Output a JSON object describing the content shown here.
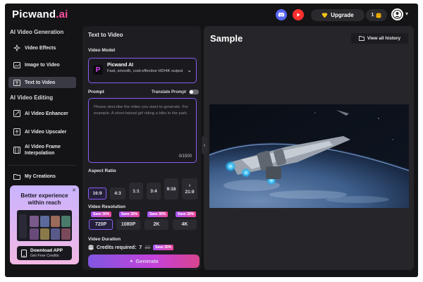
{
  "app": {
    "logo_text": "Picwand",
    "logo_suffix": ".ai"
  },
  "topbar": {
    "upgrade_label": "Upgrade",
    "credits": "1"
  },
  "sidebar": {
    "section1": "AI Video Generation",
    "items1": [
      {
        "label": "Video Effects",
        "icon": "video-effects-icon"
      },
      {
        "label": "Image to Video",
        "icon": "image-icon"
      },
      {
        "label": "Text to Video",
        "icon": "text-icon",
        "active": true
      }
    ],
    "section2": "AI Video Editing",
    "items2": [
      {
        "label": "AI Video Enhancer",
        "icon": "enhancer-icon"
      },
      {
        "label": "AI Video Upscaler",
        "icon": "upscaler-icon"
      },
      {
        "label": "AI Video Frame Interpolation",
        "line1": "AI Video Frame",
        "line2": "Interpolation",
        "icon": "frame-icon"
      }
    ],
    "creations": "My Creations"
  },
  "promo": {
    "title_line1": "Better experience",
    "title_line2": "within reach",
    "download_label": "Download APP",
    "download_sub": "Get Free Credits"
  },
  "panel": {
    "title": "Text to Video",
    "model_label": "Video Model",
    "model_name": "Picwand AI",
    "model_desc": "Fast, smooth, cost-effective HD/4K output",
    "prompt_label": "Prompt",
    "translate_label": "Translate Prompt",
    "prompt_placeholder": "Please describe the video you want to generate. For example: A short-haired girl riding a bike in the park.",
    "prompt_count": "0/1500",
    "ratio_label": "Aspect Ratio",
    "ratios": [
      "16:9",
      "4:3",
      "1:1",
      "3:4",
      "9:16",
      "21:9"
    ],
    "selected_ratio": "16:9",
    "resolution_label": "Video Resolution",
    "resolutions": [
      {
        "label": "720P",
        "tag": "Save 30%"
      },
      {
        "label": "1080P",
        "tag": "Save 30%"
      },
      {
        "label": "2K",
        "tag": "Save 30%"
      },
      {
        "label": "4K",
        "tag": "Save 30%"
      }
    ],
    "duration_label": "Video Duration",
    "credits_label": "Credits required:",
    "credits_value": "7",
    "credits_old": "10",
    "credits_tag": "Save 30%",
    "generate_label": "Generate"
  },
  "sample": {
    "title": "Sample",
    "history_label": "View all history"
  },
  "colors": {
    "accent": "#8b5cf6",
    "pink": "#ec4899",
    "bg": "#141416",
    "panel": "#1e1e22"
  }
}
